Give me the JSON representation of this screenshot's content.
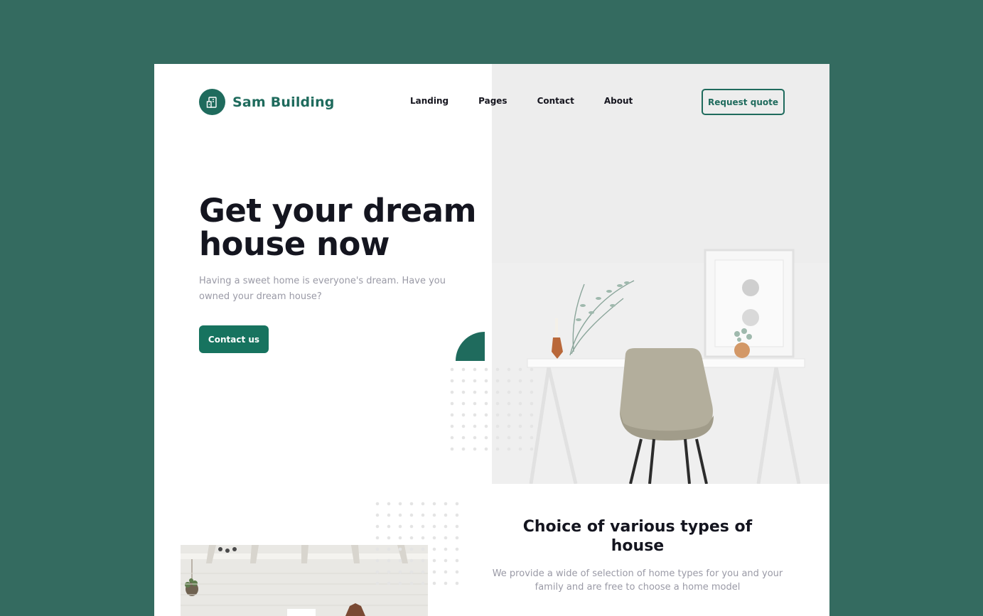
{
  "brand": {
    "name": "Sam Building",
    "color": "#1f6b5d"
  },
  "nav": {
    "items": [
      "Landing",
      "Pages",
      "Contact",
      "About"
    ],
    "cta": "Request quote"
  },
  "hero": {
    "title_line1": "Get your dream",
    "title_line2": "house now",
    "subtitle": "Having a sweet home is everyone's dream. Have you owned your dream house?",
    "button": "Contact us"
  },
  "section": {
    "title": "Choice of various types of house",
    "subtitle": "We provide a wide of selection of home types for you and your family and are free to choose a home model"
  },
  "colors": {
    "page_bg": "#346b60",
    "accent": "#17735f",
    "heading": "#14151f",
    "muted": "#9a9aa6"
  }
}
